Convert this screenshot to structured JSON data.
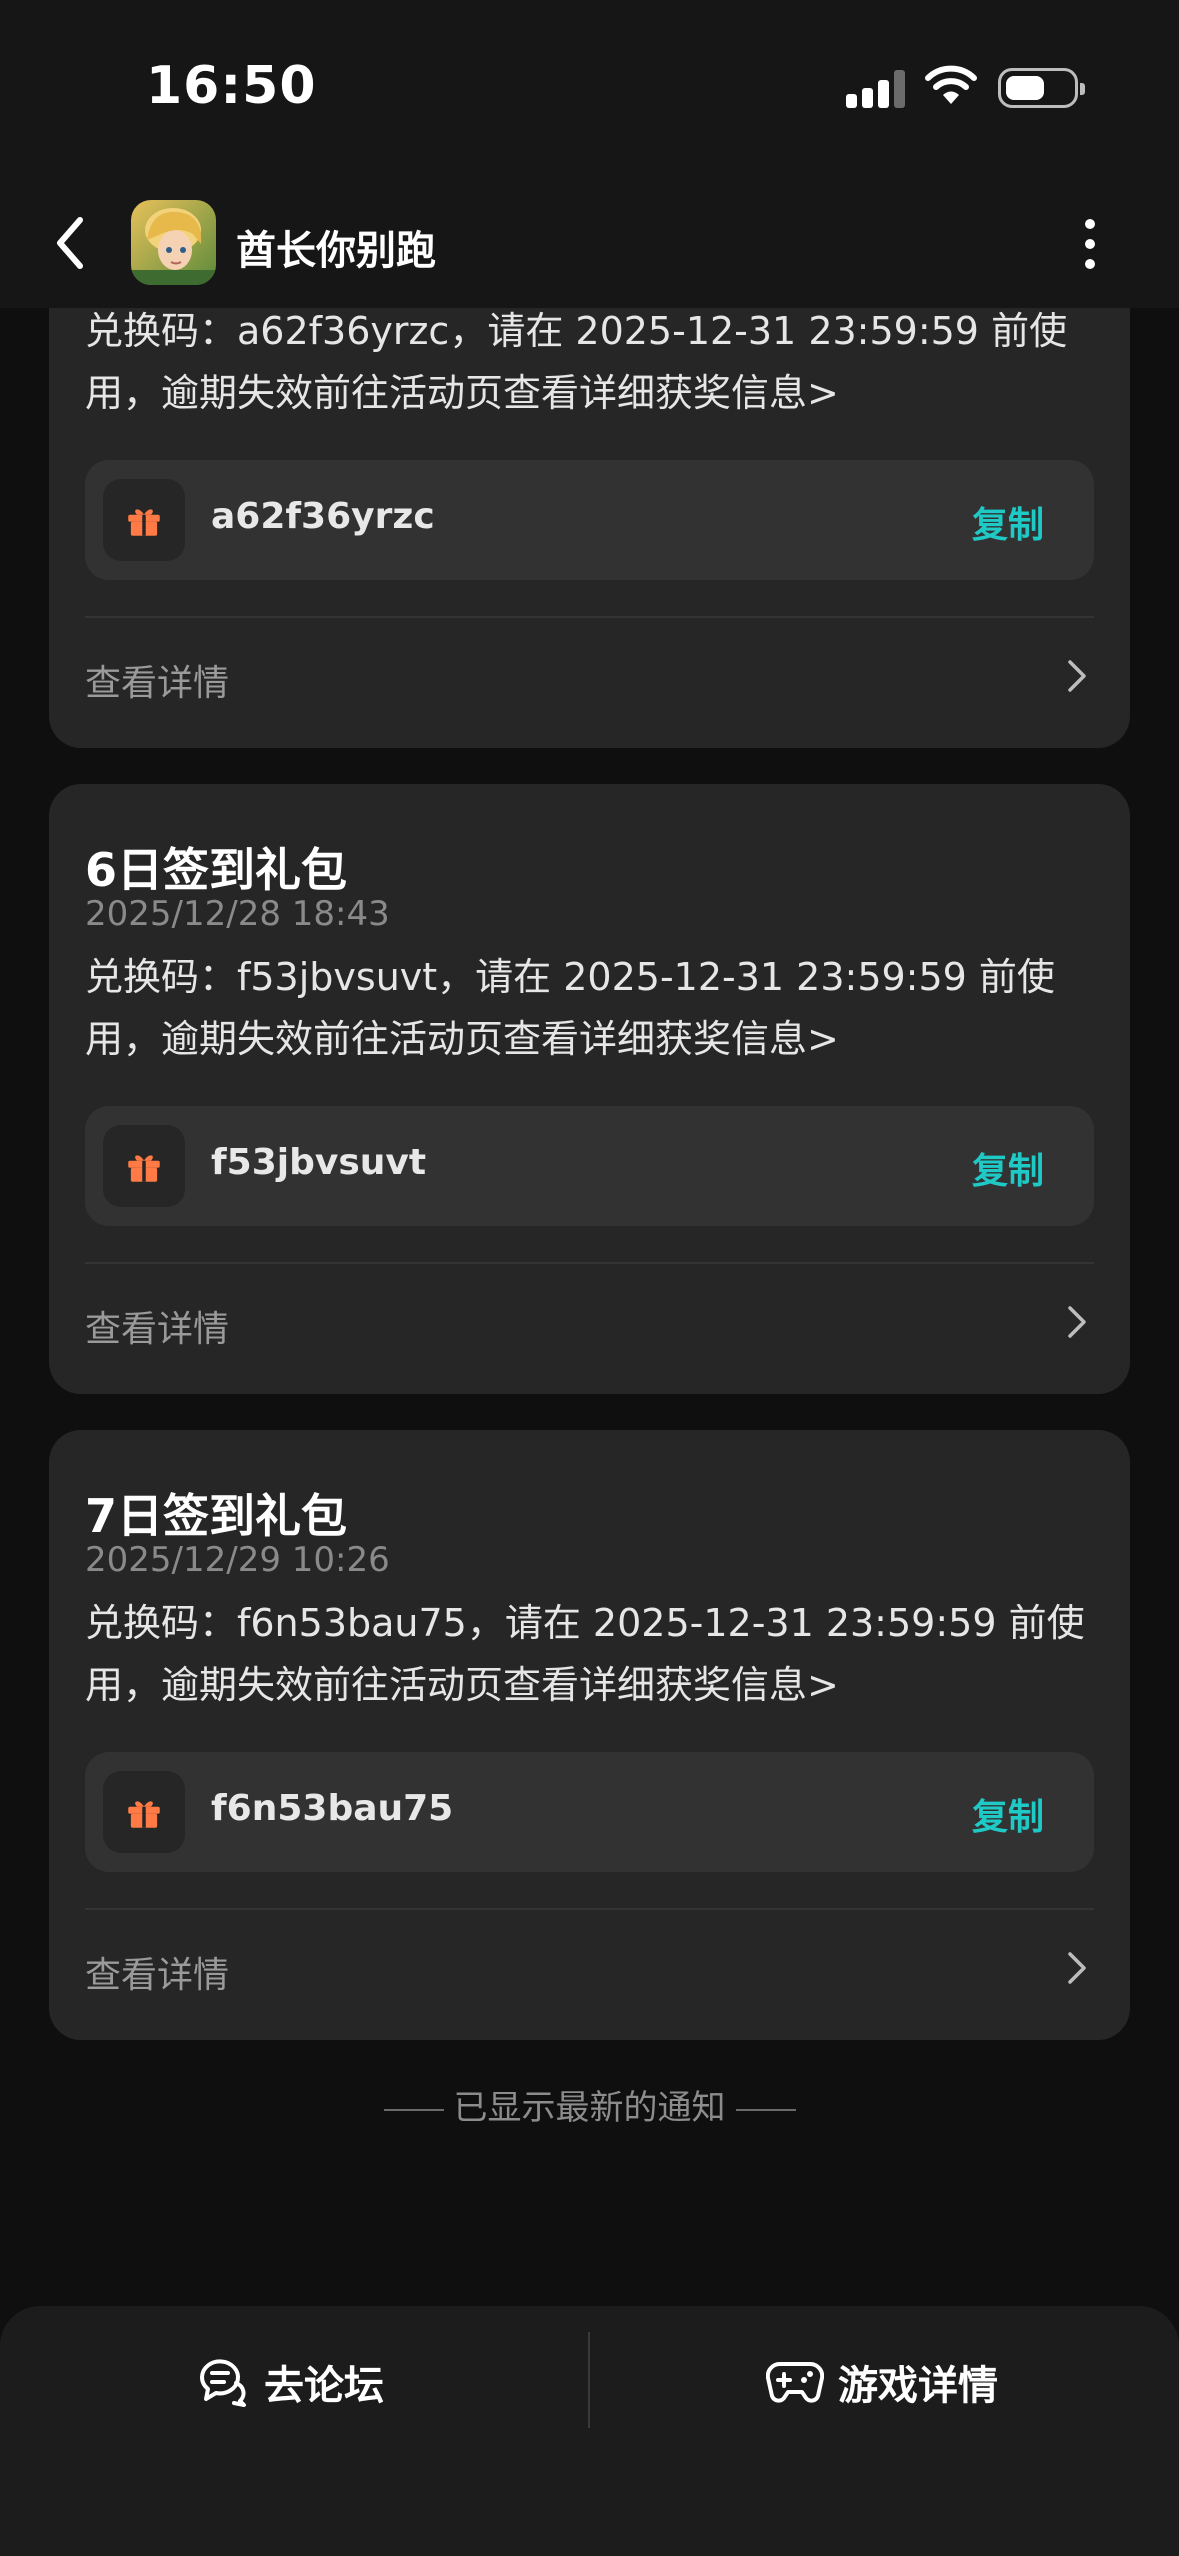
{
  "status_bar": {
    "time": "16:50"
  },
  "nav": {
    "title": "酋长你别跑"
  },
  "cards": [
    {
      "body": "兑换码：a62f36yrzc，请在 2025-12-31 23:59:59 前使用，逾期失效前往活动页查看详细获奖信息>",
      "code": "a62f36yrzc",
      "copy_label": "复制",
      "detail_label": "查看详情"
    },
    {
      "title": "6日签到礼包",
      "date": "2025/12/28 18:43",
      "body": "兑换码：f53jbvsuvt，请在 2025-12-31 23:59:59 前使用，逾期失效前往活动页查看详细获奖信息>",
      "code": "f53jbvsuvt",
      "copy_label": "复制",
      "detail_label": "查看详情"
    },
    {
      "title": "7日签到礼包",
      "date": "2025/12/29 10:26",
      "body": "兑换码：f6n53bau75，请在 2025-12-31 23:59:59 前使用，逾期失效前往活动页查看详细获奖信息>",
      "code": "f6n53bau75",
      "copy_label": "复制",
      "detail_label": "查看详情"
    }
  ],
  "footer_note": "已显示最新的通知",
  "bottom_bar": {
    "forum_label": "去论坛",
    "game_detail_label": "游戏详情"
  },
  "colors": {
    "accent": "#1fc9c6",
    "gift": "#ff7a45",
    "card": "#262626"
  }
}
